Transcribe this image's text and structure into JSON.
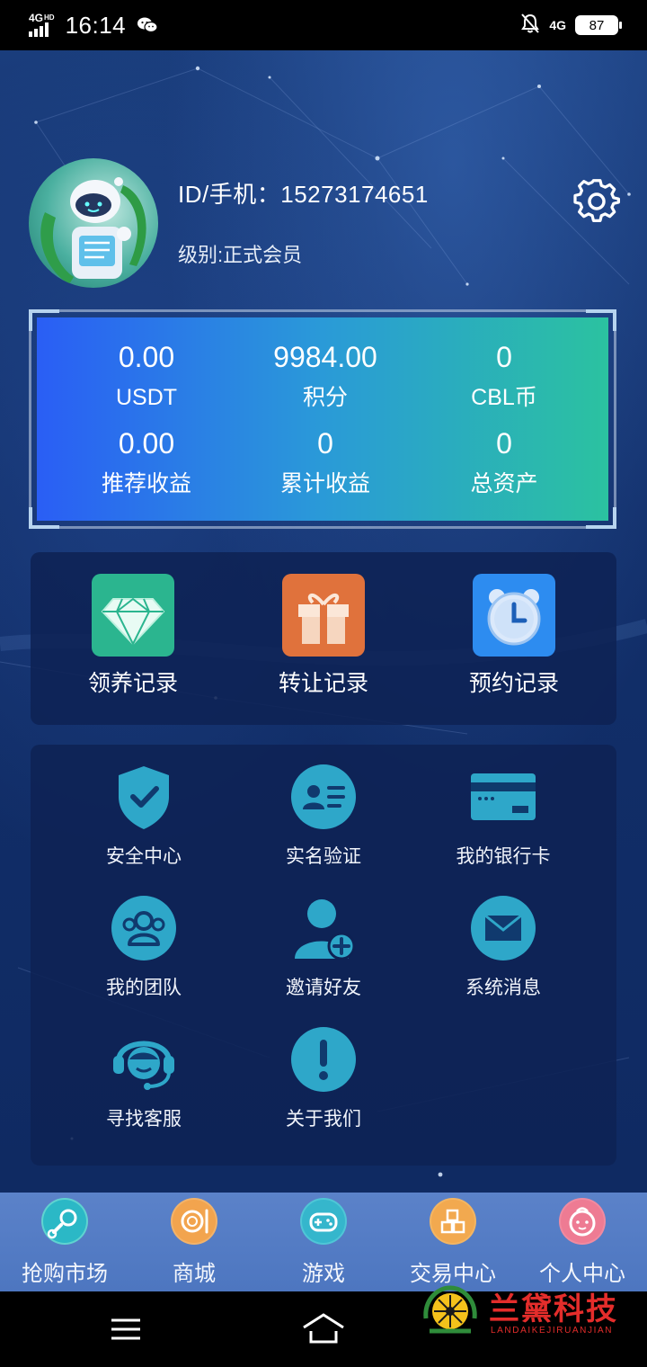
{
  "status_bar": {
    "network": "4G",
    "network_tag": "HD",
    "time": "16:14",
    "right_network": "4G",
    "battery": "87"
  },
  "profile": {
    "id_label": "ID/手机：",
    "id_value": "15273174651",
    "level_label": "级别:",
    "level_value": "正式会员"
  },
  "stats": [
    {
      "value": "0.00",
      "label": "USDT"
    },
    {
      "value": "9984.00",
      "label": "积分"
    },
    {
      "value": "0",
      "label": "CBL币"
    },
    {
      "value": "0.00",
      "label": "推荐收益"
    },
    {
      "value": "0",
      "label": "累计收益"
    },
    {
      "value": "0",
      "label": "总资产"
    }
  ],
  "records": [
    {
      "label": "领养记录",
      "icon": "diamond-icon",
      "color": "#2bb58f"
    },
    {
      "label": "转让记录",
      "icon": "gift-icon",
      "color": "#e0723c"
    },
    {
      "label": "预约记录",
      "icon": "alarm-clock-icon",
      "color": "#2d8cf0"
    }
  ],
  "menu": [
    {
      "label": "安全中心",
      "icon": "shield-check-icon"
    },
    {
      "label": "实名验证",
      "icon": "id-card-icon"
    },
    {
      "label": "我的银行卡",
      "icon": "bank-card-icon"
    },
    {
      "label": "我的团队",
      "icon": "team-icon"
    },
    {
      "label": "邀请好友",
      "icon": "add-user-icon"
    },
    {
      "label": "系统消息",
      "icon": "mail-icon"
    },
    {
      "label": "寻找客服",
      "icon": "customer-service-icon"
    },
    {
      "label": "关于我们",
      "icon": "info-exclamation-icon"
    }
  ],
  "tabs": [
    {
      "label": "抢购市场",
      "icon": "pacifier-icon",
      "color": "#5fd3d0"
    },
    {
      "label": "商城",
      "icon": "dish-icon",
      "color": "#f2b36a"
    },
    {
      "label": "游戏",
      "icon": "gamepad-icon",
      "color": "#4fc6d6"
    },
    {
      "label": "交易中心",
      "icon": "blocks-icon",
      "color": "#f3b562"
    },
    {
      "label": "个人中心",
      "icon": "baby-face-icon",
      "color": "#f08aa0"
    }
  ],
  "watermark": {
    "title": "兰黛科技",
    "subtitle": "LANDAIKEJIRUANJIAN"
  },
  "colors": {
    "accent_teal": "#2ea7c9",
    "card_gradient_start": "#2a5ef5",
    "card_gradient_end": "#2bc2a0",
    "tabbar": "#5078c2"
  }
}
